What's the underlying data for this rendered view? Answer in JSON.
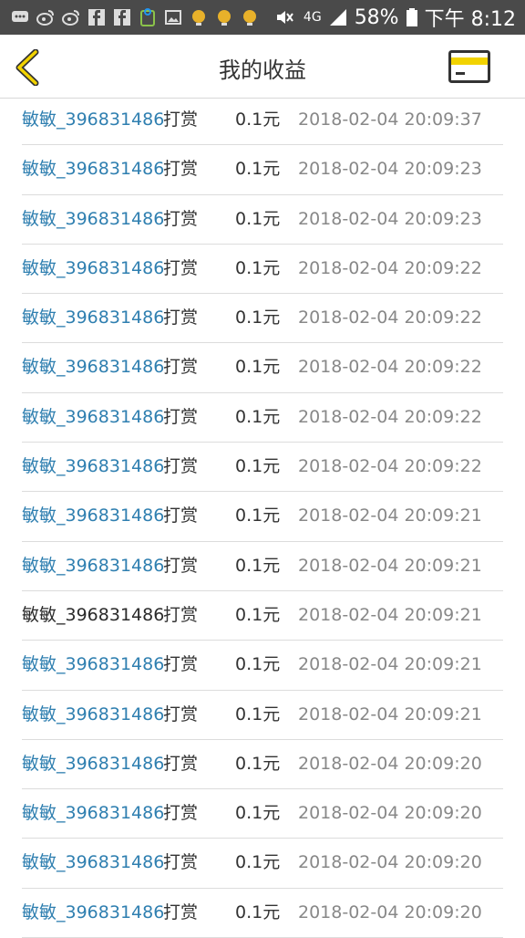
{
  "status_bar": {
    "network": "4G",
    "battery": "58%",
    "time": "下午 8:12"
  },
  "header": {
    "title": "我的收益"
  },
  "records": [
    {
      "user": "敏敏_396831486",
      "action": "打赏",
      "amount": "0.1元",
      "time": "2018-02-04 20:09:37"
    },
    {
      "user": "敏敏_396831486",
      "action": "打赏",
      "amount": "0.1元",
      "time": "2018-02-04 20:09:23"
    },
    {
      "user": "敏敏_396831486",
      "action": "打赏",
      "amount": "0.1元",
      "time": "2018-02-04 20:09:23"
    },
    {
      "user": "敏敏_396831486",
      "action": "打赏",
      "amount": "0.1元",
      "time": "2018-02-04 20:09:22"
    },
    {
      "user": "敏敏_396831486",
      "action": "打赏",
      "amount": "0.1元",
      "time": "2018-02-04 20:09:22"
    },
    {
      "user": "敏敏_396831486",
      "action": "打赏",
      "amount": "0.1元",
      "time": "2018-02-04 20:09:22"
    },
    {
      "user": "敏敏_396831486",
      "action": "打赏",
      "amount": "0.1元",
      "time": "2018-02-04 20:09:22"
    },
    {
      "user": "敏敏_396831486",
      "action": "打赏",
      "amount": "0.1元",
      "time": "2018-02-04 20:09:22"
    },
    {
      "user": "敏敏_396831486",
      "action": "打赏",
      "amount": "0.1元",
      "time": "2018-02-04 20:09:21"
    },
    {
      "user": "敏敏_396831486",
      "action": "打赏",
      "amount": "0.1元",
      "time": "2018-02-04 20:09:21"
    },
    {
      "user": "敏敏_396831486",
      "action": "打赏",
      "amount": "0.1元",
      "time": "2018-02-04 20:09:21"
    },
    {
      "user": "敏敏_396831486",
      "action": "打赏",
      "amount": "0.1元",
      "time": "2018-02-04 20:09:21"
    },
    {
      "user": "敏敏_396831486",
      "action": "打赏",
      "amount": "0.1元",
      "time": "2018-02-04 20:09:21"
    },
    {
      "user": "敏敏_396831486",
      "action": "打赏",
      "amount": "0.1元",
      "time": "2018-02-04 20:09:20"
    },
    {
      "user": "敏敏_396831486",
      "action": "打赏",
      "amount": "0.1元",
      "time": "2018-02-04 20:09:20"
    },
    {
      "user": "敏敏_396831486",
      "action": "打赏",
      "amount": "0.1元",
      "time": "2018-02-04 20:09:20"
    },
    {
      "user": "敏敏_396831486",
      "action": "打赏",
      "amount": "0.1元",
      "time": "2018-02-04 20:09:20"
    }
  ],
  "colors": {
    "status_bar_bg": "#4a4a4a",
    "accent_yellow": "#f2d300",
    "user_link": "#2f7fb0",
    "timestamp": "#888888"
  },
  "icons": {
    "status_left": [
      "chat-icon",
      "weibo-icon",
      "weibo-icon",
      "facebook-icon",
      "facebook-icon",
      "app-icon",
      "image-icon",
      "bulb-icon",
      "bulb-icon",
      "bulb-icon"
    ],
    "status_right": [
      "mute-icon",
      "signal-icon",
      "battery-icon"
    ],
    "nav_left": "back-chevron-icon",
    "nav_right": "card-icon"
  }
}
